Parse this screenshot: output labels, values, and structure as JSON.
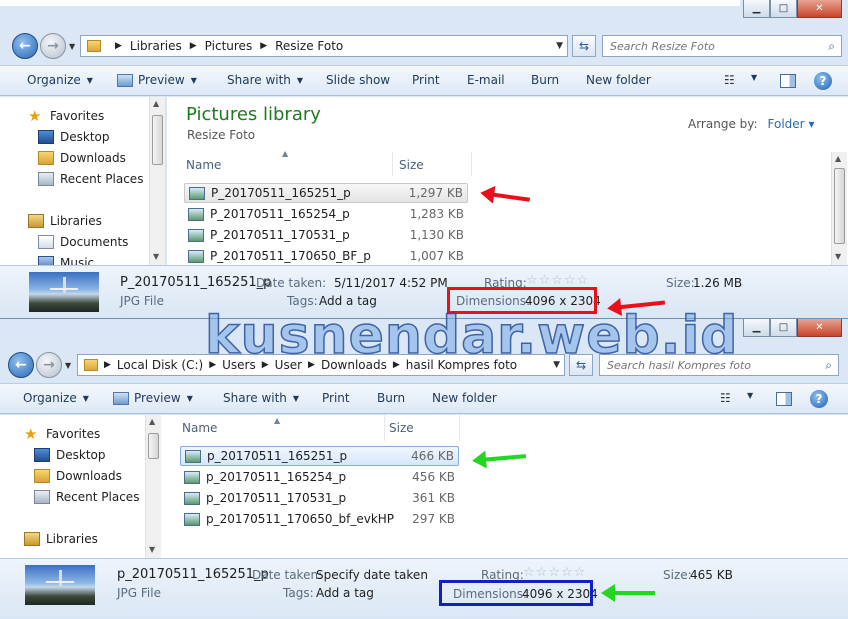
{
  "watermark": "kusnendar.web.id",
  "window1": {
    "caption_buttons": {
      "minimize": "▁",
      "maximize": "□",
      "close": "✕"
    },
    "address": {
      "segments": [
        "Libraries",
        "Pictures",
        "Resize Foto"
      ]
    },
    "search_placeholder": "Search Resize Foto",
    "toolbar": {
      "organize": "Organize",
      "preview": "Preview",
      "share_with": "Share with",
      "slide_show": "Slide show",
      "print": "Print",
      "email": "E-mail",
      "burn": "Burn",
      "new_folder": "New folder"
    },
    "nav": {
      "favorites": "Favorites",
      "desktop": "Desktop",
      "downloads": "Downloads",
      "recent_places": "Recent Places",
      "libraries": "Libraries",
      "documents": "Documents",
      "music": "Music"
    },
    "library_title": "Pictures library",
    "library_sub": "Resize Foto",
    "arrange_label": "Arrange by:",
    "arrange_value": "Folder",
    "columns": {
      "name": "Name",
      "size": "Size"
    },
    "files": [
      {
        "name": "P_20170511_165251_p",
        "size": "1,297 KB"
      },
      {
        "name": "P_20170511_165254_p",
        "size": "1,283 KB"
      },
      {
        "name": "P_20170511_170531_p",
        "size": "1,130 KB"
      },
      {
        "name": "P_20170511_170650_BF_p",
        "size": "1,007 KB"
      }
    ],
    "details": {
      "filename": "P_20170511_165251_p",
      "filetype": "JPG File",
      "date_label": "Date taken:",
      "date_value": "5/11/2017 4:52 PM",
      "tags_label": "Tags:",
      "tags_value": "Add a tag",
      "rating_label": "Rating:",
      "dimensions_label": "Dimensions:",
      "dimensions_value": "4096 x 2304",
      "size_label": "Size:",
      "size_value": "1.26 MB"
    },
    "highlight_color": "#e8111a",
    "arrow_color": "#e8111a"
  },
  "window2": {
    "caption_buttons": {
      "minimize": "▁",
      "maximize": "□",
      "close": "✕"
    },
    "address": {
      "segments": [
        "Local Disk (C:)",
        "Users",
        "User",
        "Downloads",
        "hasil Kompres foto"
      ]
    },
    "search_placeholder": "Search hasil Kompres foto",
    "toolbar": {
      "organize": "Organize",
      "preview": "Preview",
      "share_with": "Share with",
      "print": "Print",
      "burn": "Burn",
      "new_folder": "New folder"
    },
    "nav": {
      "favorites": "Favorites",
      "desktop": "Desktop",
      "downloads": "Downloads",
      "recent_places": "Recent Places",
      "libraries": "Libraries"
    },
    "columns": {
      "name": "Name",
      "size": "Size"
    },
    "files": [
      {
        "name": "p_20170511_165251_p",
        "size": "466 KB"
      },
      {
        "name": "p_20170511_165254_p",
        "size": "456 KB"
      },
      {
        "name": "p_20170511_170531_p",
        "size": "361 KB"
      },
      {
        "name": "p_20170511_170650_bf_evkHP",
        "size": "297 KB"
      }
    ],
    "details": {
      "filename": "p_20170511_165251_p",
      "filetype": "JPG File",
      "date_label": "Date taken:",
      "date_value": "Specify date taken",
      "tags_label": "Tags:",
      "tags_value": "Add a tag",
      "rating_label": "Rating:",
      "dimensions_label": "Dimensions:",
      "dimensions_value": "4096 x 2304",
      "size_label": "Size:",
      "size_value": "465 KB"
    },
    "highlight_color": "#1020c8",
    "arrow_color": "#22d622"
  }
}
